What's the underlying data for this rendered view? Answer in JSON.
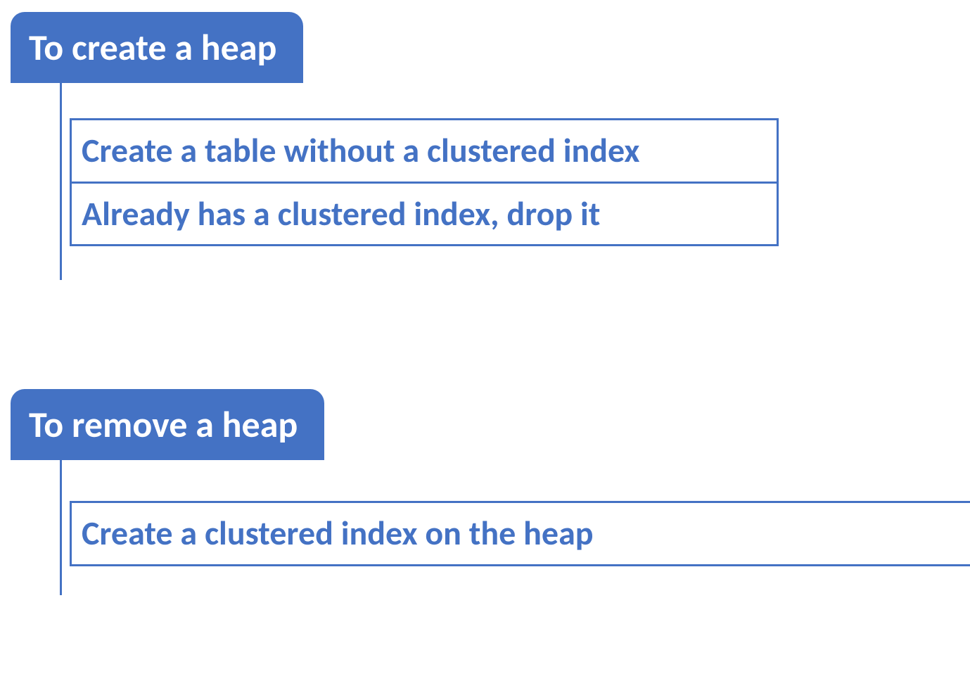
{
  "sections": [
    {
      "header": "To create a heap",
      "items": [
        "Create a table without a clustered index",
        "Already has a clustered index, drop it"
      ]
    },
    {
      "header": "To remove a heap",
      "items": [
        "Create a clustered index on the heap"
      ]
    }
  ]
}
